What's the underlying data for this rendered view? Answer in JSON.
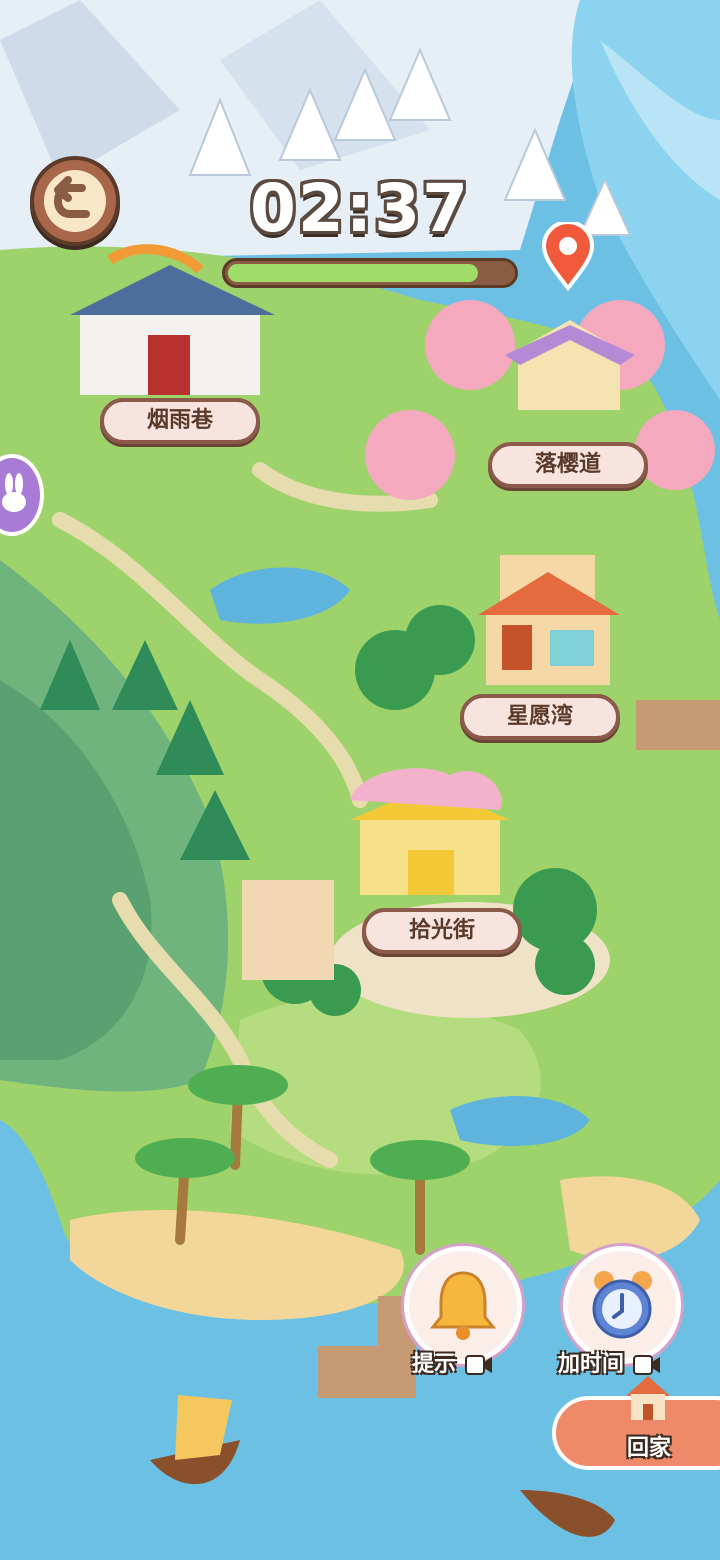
{
  "hud": {
    "timer": "02:37",
    "time_progress": 0.88
  },
  "locations": [
    {
      "name": "烟雨巷"
    },
    {
      "name": "落樱道"
    },
    {
      "name": "星愿湾"
    },
    {
      "name": "拾光街"
    }
  ],
  "actions": {
    "hint_label": "提示",
    "add_time_label": "加时间",
    "home_label": "回家"
  },
  "icons": {
    "back": "back-arrow-icon",
    "location_pin": "location-pin-icon",
    "hint": "bell-icon",
    "add_time": "alarm-clock-icon",
    "video_ad": "video-camera-icon",
    "home": "house-icon",
    "side": "bunny-icon"
  },
  "colors": {
    "progress_fill": "#9fdc6a",
    "progress_track": "#8a5c43",
    "banner_bg": "#f7e4de",
    "home_button": "#ee8a6a"
  }
}
